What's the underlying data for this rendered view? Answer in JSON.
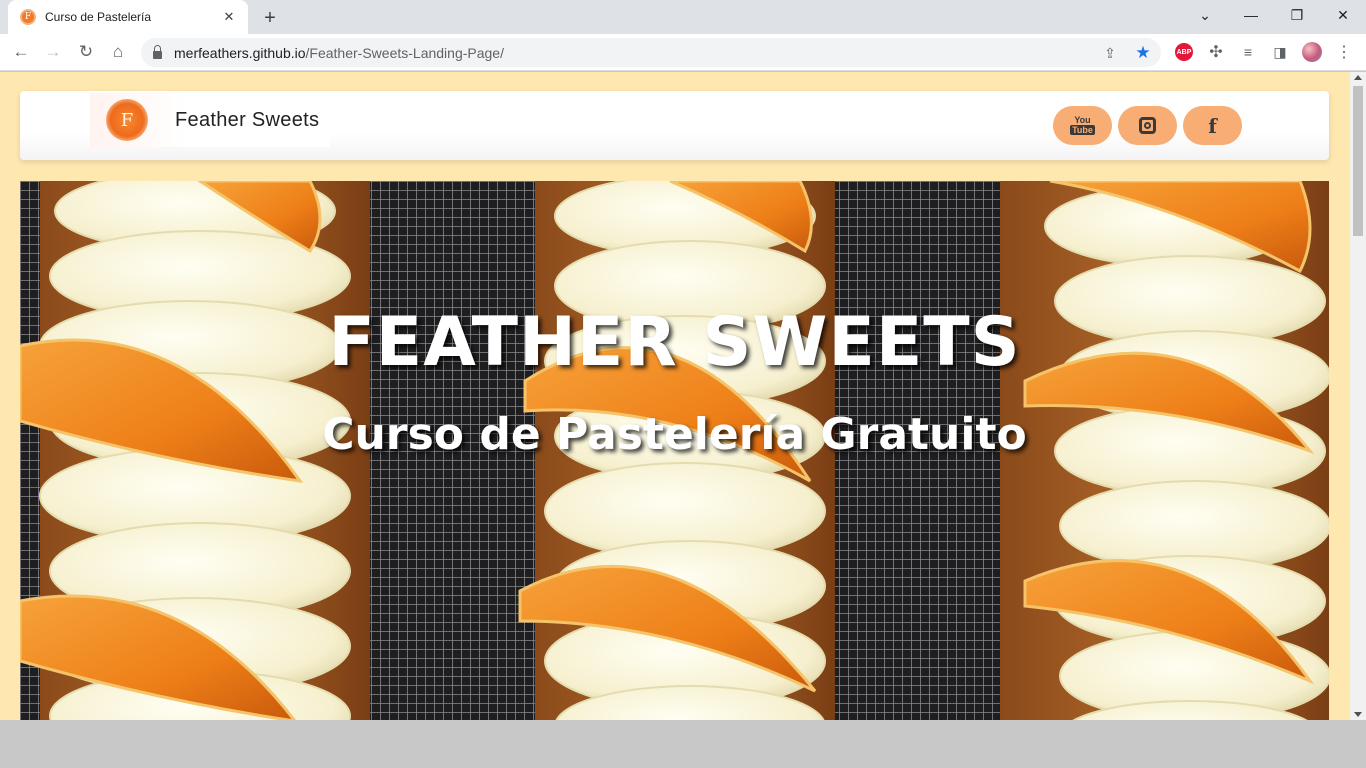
{
  "browser": {
    "tab_title": "Curso de Pastelería",
    "url_host": "merfeathers.github.io",
    "url_path": "/Feather-Sweets-Landing-Page/",
    "favicon_letter": "F",
    "abp_label": "ABP"
  },
  "header": {
    "logo_letter": "F",
    "brand_name": "Feather Sweets",
    "social": {
      "youtube_top": "You",
      "youtube_bottom": "Tube",
      "facebook_glyph": "f"
    }
  },
  "hero": {
    "title": "FEATHER SWEETS",
    "subtitle": "Curso de Pastelería Gratuito"
  },
  "colors": {
    "page_background": "#ffe7b0",
    "social_button": "#f7ad74",
    "logo_orange": "#ef6a1c"
  }
}
